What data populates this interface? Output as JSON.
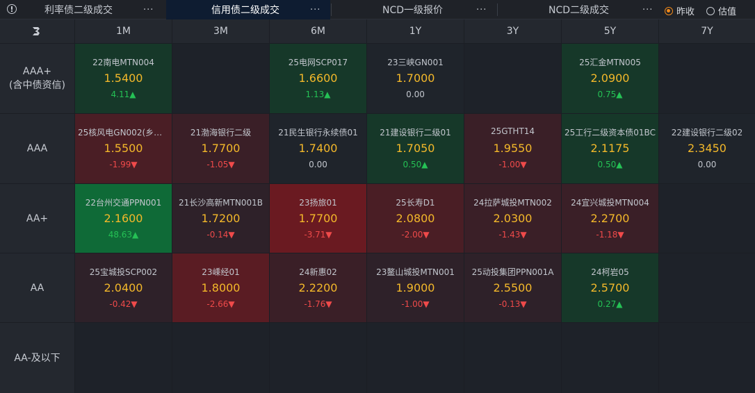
{
  "tabs": [
    {
      "label": "利率债二级成交",
      "active": false
    },
    {
      "label": "信用债二级成交",
      "active": true
    },
    {
      "label": "NCD一级报价",
      "active": false
    },
    {
      "label": "NCD二级成交",
      "active": false
    }
  ],
  "more_glyph": "···",
  "radios": [
    {
      "label": "昨收",
      "checked": true
    },
    {
      "label": "估值",
      "checked": false
    }
  ],
  "columns": [
    "1M",
    "3M",
    "6M",
    "1Y",
    "3Y",
    "5Y",
    "7Y"
  ],
  "rows": [
    {
      "label": "AAA+\n(含中债资信)",
      "cells": [
        {
          "name": "22南电MTN004",
          "price": "1.5400",
          "chg": "4.11▲",
          "dir": "up",
          "bg": "#163829"
        },
        null,
        {
          "name": "25电网SCP017",
          "price": "1.6600",
          "chg": "1.13▲",
          "dir": "up",
          "bg": "#163829"
        },
        {
          "name": "23三峡GN001",
          "price": "1.7000",
          "chg": "0.00",
          "dir": "flat",
          "bg": "#1f242b"
        },
        null,
        {
          "name": "25汇金MTN005",
          "price": "2.0900",
          "chg": "0.75▲",
          "dir": "up",
          "bg": "#163829"
        },
        null
      ]
    },
    {
      "label": "AAA",
      "cells": [
        {
          "name": "25核风电GN002(乡村...",
          "price": "1.5500",
          "chg": "-1.99▼",
          "dir": "down",
          "bg": "#4a1e25"
        },
        {
          "name": "21渤海银行二级",
          "price": "1.7700",
          "chg": "-1.05▼",
          "dir": "down",
          "bg": "#3a1f27"
        },
        {
          "name": "21民生银行永续债01",
          "price": "1.7400",
          "chg": "0.00",
          "dir": "flat",
          "bg": "#1f242b"
        },
        {
          "name": "21建设银行二级01",
          "price": "1.7050",
          "chg": "0.50▲",
          "dir": "up",
          "bg": "#163829"
        },
        {
          "name": "25GTHT14",
          "price": "1.9550",
          "chg": "-1.00▼",
          "dir": "down",
          "bg": "#3a1f27"
        },
        {
          "name": "25工行二级资本债01BC",
          "price": "2.1175",
          "chg": "0.50▲",
          "dir": "up",
          "bg": "#163829"
        },
        {
          "name": "22建设银行二级02",
          "price": "2.3450",
          "chg": "0.00",
          "dir": "flat",
          "bg": "#1f242b"
        }
      ]
    },
    {
      "label": "AA+",
      "cells": [
        {
          "name": "22台州交通PPN001",
          "price": "2.1600",
          "chg": "48.63▲",
          "dir": "up",
          "bg": "#0f6a37"
        },
        {
          "name": "21长沙高新MTN001B",
          "price": "1.7200",
          "chg": "-0.14▼",
          "dir": "down",
          "bg": "#2e2129"
        },
        {
          "name": "23扬旅01",
          "price": "1.7700",
          "chg": "-3.71▼",
          "dir": "down",
          "bg": "#6a1a21"
        },
        {
          "name": "25长寿D1",
          "price": "2.0800",
          "chg": "-2.00▼",
          "dir": "down",
          "bg": "#4a1e25"
        },
        {
          "name": "24拉萨城投MTN002",
          "price": "2.0300",
          "chg": "-1.43▼",
          "dir": "down",
          "bg": "#3a1f27"
        },
        {
          "name": "24宜兴城投MTN004",
          "price": "2.2700",
          "chg": "-1.18▼",
          "dir": "down",
          "bg": "#3a1f27"
        },
        null
      ]
    },
    {
      "label": "AA",
      "cells": [
        {
          "name": "25宝城投SCP002",
          "price": "2.0400",
          "chg": "-0.42▼",
          "dir": "down",
          "bg": "#2e2129"
        },
        {
          "name": "23嵊经01",
          "price": "1.8000",
          "chg": "-2.66▼",
          "dir": "down",
          "bg": "#5a1c23"
        },
        {
          "name": "24新惠02",
          "price": "2.2200",
          "chg": "-1.76▼",
          "dir": "down",
          "bg": "#3a1f27"
        },
        {
          "name": "23鳌山城投MTN001",
          "price": "1.9000",
          "chg": "-1.00▼",
          "dir": "down",
          "bg": "#2e2129"
        },
        {
          "name": "25动投集团PPN001A",
          "price": "2.5500",
          "chg": "-0.13▼",
          "dir": "down",
          "bg": "#2e2129"
        },
        {
          "name": "24柯岩05",
          "price": "2.5700",
          "chg": "0.27▲",
          "dir": "up",
          "bg": "#163829"
        },
        null
      ]
    },
    {
      "label": "AA-及以下",
      "cells": [
        null,
        null,
        null,
        null,
        null,
        null,
        null
      ]
    }
  ],
  "colors": {
    "accent": "#f28a1a",
    "up": "#25c155",
    "down": "#ef4a4a",
    "price": "#f3b82a",
    "empty_cell": "#1e2229"
  }
}
